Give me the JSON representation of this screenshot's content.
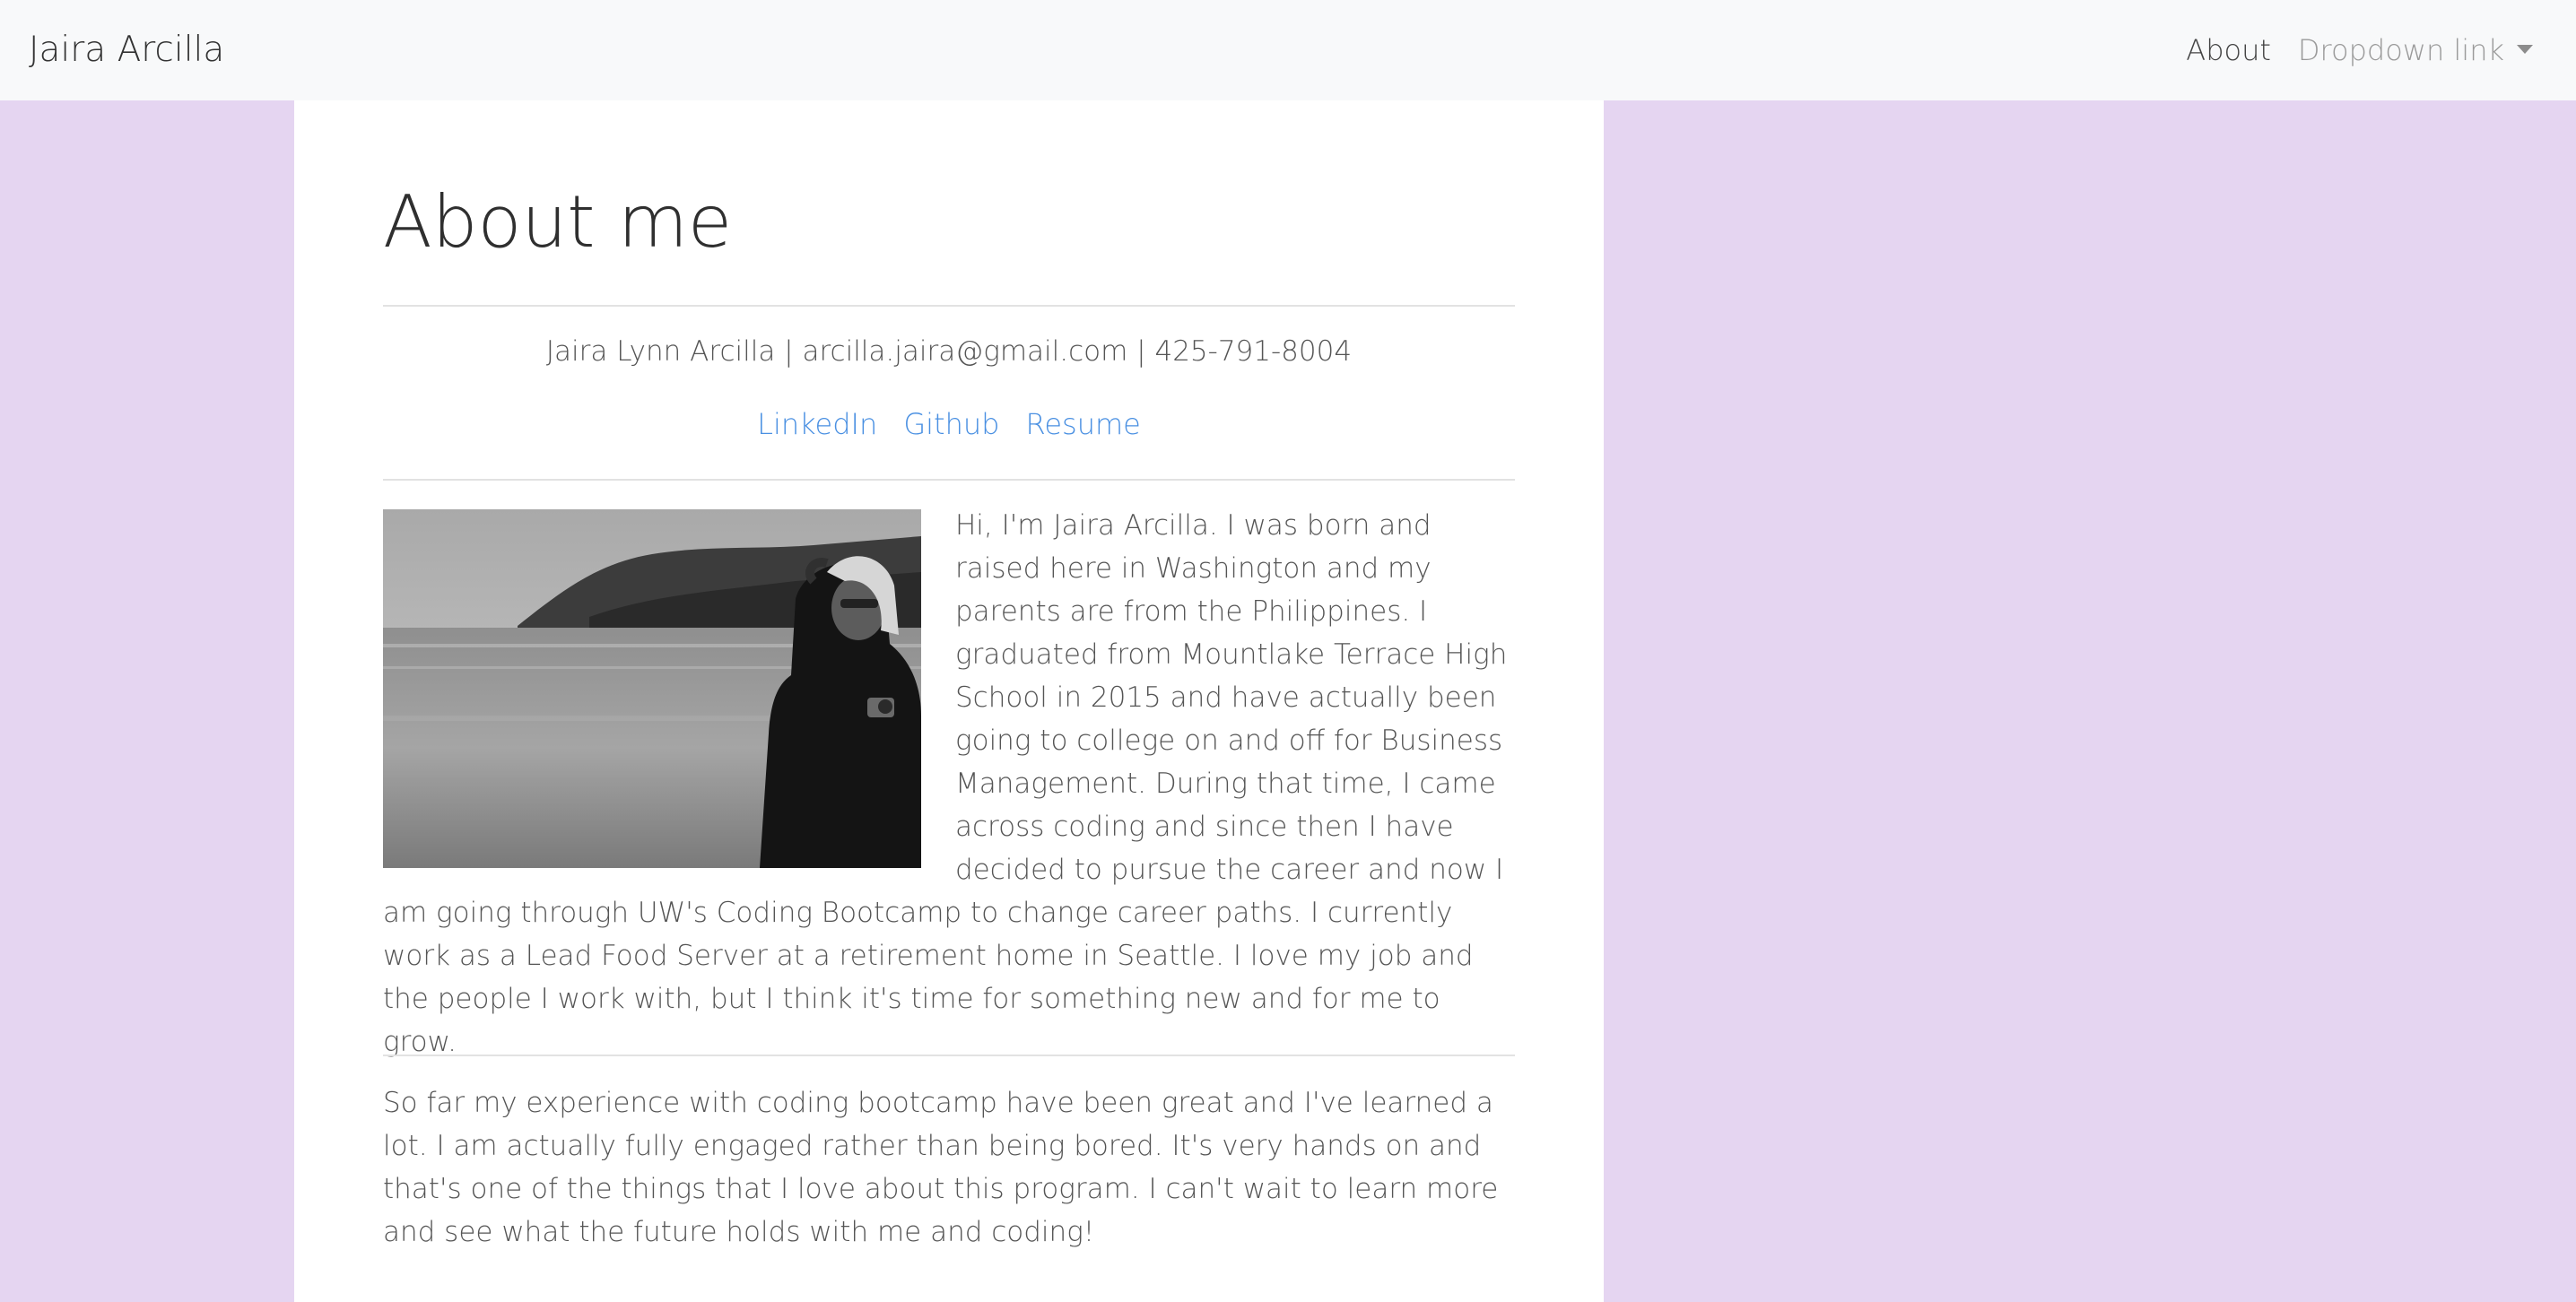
{
  "navbar": {
    "brand": "Jaira Arcilla",
    "links": [
      {
        "label": "About"
      },
      {
        "label": "Dropdown link"
      }
    ]
  },
  "main": {
    "title": "About me",
    "contact": "Jaira Lynn Arcilla | arcilla.jaira@gmail.com | 425-791-8004",
    "links": [
      "LinkedIn",
      "Github",
      "Resume"
    ],
    "bio": "Hi, I'm Jaira Arcilla. I was born and raised here in Washington and my parents are from the Philippines. I graduated from Mountlake Terrace High School in 2015 and have actually been going to college on and off for Business Management. During that time, I came across coding and since then I have decided to pursue the career and now I am going through UW's Coding Bootcamp to change career paths. I currently work as a Lead Food Server at a retirement home in Seattle. I love my job and the people I work with, but I think it's time for something new and for me to grow.",
    "experience": "So far my experience with coding bootcamp have been great and I've learned a lot. I am actually fully engaged rather than being bored. It's very hands on and that's one of the things that I love about this program. I can't wait to learn more and see what the future holds with me and coding!"
  },
  "colors": {
    "page_background": "#e5d5f1",
    "navbar_background": "#f8f9fa",
    "link": "#4a90e2"
  }
}
